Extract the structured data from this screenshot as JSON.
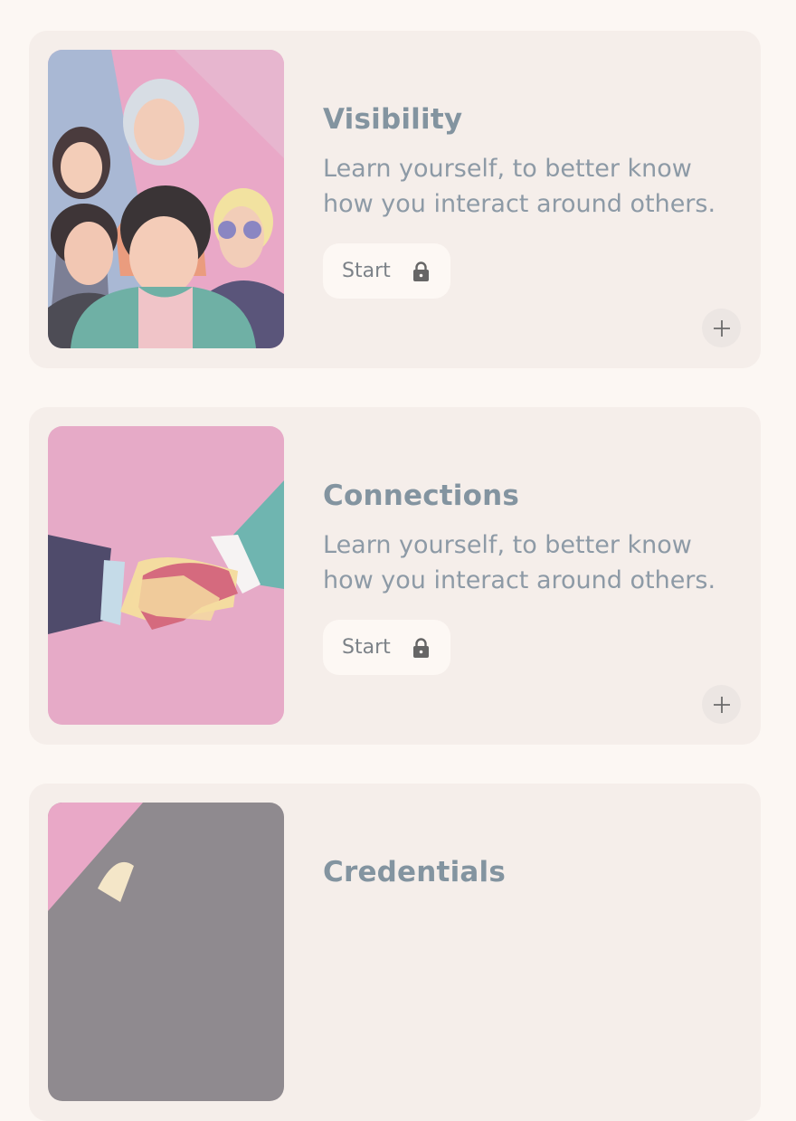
{
  "cards": [
    {
      "title": "Visibility",
      "description": "Learn yourself, to better know how you interact around others.",
      "start_label": "Start",
      "locked": true
    },
    {
      "title": "Connections",
      "description": "Learn yourself, to better know how you interact around others.",
      "start_label": "Start",
      "locked": true
    },
    {
      "title": "Credentials"
    }
  ],
  "icons": {
    "start": "lock-icon",
    "add": "plus-icon"
  },
  "colors": {
    "page_background": "#fcf7f3",
    "card_background": "#f5eeea",
    "title": "#8394a0",
    "description": "#8d9aa6",
    "button_background": "#fdf8f4"
  }
}
